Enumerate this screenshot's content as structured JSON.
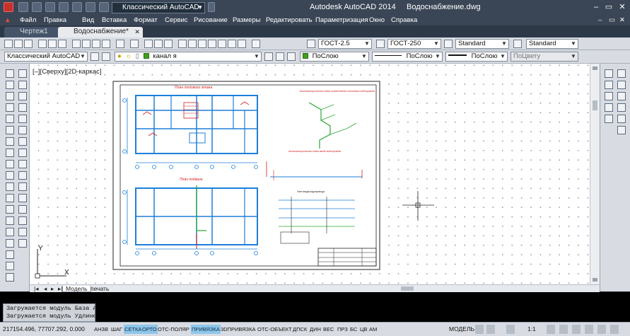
{
  "window": {
    "app_title": "Autodesk AutoCAD 2014",
    "document_title": "Водоснабжение.dwg",
    "workspace": "Классический AutoCAD",
    "controls": {
      "minimize": "–",
      "maximize": "▭",
      "close": "✕"
    }
  },
  "menu": [
    "Файл",
    "Правка",
    "Вид",
    "Вставка",
    "Формат",
    "Сервис",
    "Рисование",
    "Размеры",
    "Редактировать",
    "Параметризация",
    "Окно",
    "Справка"
  ],
  "tabs": [
    {
      "label": "Чертеж1",
      "active": false
    },
    {
      "label": "Водоснабжение*",
      "active": true
    }
  ],
  "toolbar1": {
    "text_style": "ГОСТ-2.5",
    "dim_style": "ГОСТ-250",
    "table_style": "Standard",
    "mleader_style": "Standard"
  },
  "toolbar2": {
    "workspace": "Классический AutoCAD",
    "layer": "канал я",
    "color": "ПоСлою",
    "linetype": "ПоСлою",
    "lineweight": "ПоСлою",
    "plotstyle": "ПоЦвету",
    "layer_color": "#3fa01c"
  },
  "viewport": {
    "label": "[–][Сверху][2D-каркас]",
    "ucs_x": "X",
    "ucs_y": "Y"
  },
  "drawing": {
    "plan1_title": "План типового этажа",
    "plan2_title": "План подвала",
    "scheme1_title": "Аксонометрическая схема хозяйственно-питьевого водопровода",
    "scheme2_title": "Аксонометрическая схема ввода водопровода",
    "node_title": "Узел ввода водопровода"
  },
  "layout_tabs": [
    {
      "label": "Модель",
      "active": true
    },
    {
      "label": "печать",
      "active": false
    }
  ],
  "command_lines": [
    "Загружается модуль База А",
    "Загружается модуль Удлине"
  ],
  "status": {
    "coords": "217154.496, 77707.292, 0.000",
    "buttons": [
      {
        "label": "АНЗВ",
        "on": false
      },
      {
        "label": "ШАГ",
        "on": false
      },
      {
        "label": "СЕТКА",
        "on": true
      },
      {
        "label": "ОРТО",
        "on": true
      },
      {
        "label": "ОТС-ПОЛЯР",
        "on": false
      },
      {
        "label": "ПРИВЯЗКА",
        "on": true
      },
      {
        "label": "3DПРИВЯЗКА",
        "on": false
      },
      {
        "label": "ОТС-ОБЪЕКТ",
        "on": false
      },
      {
        "label": "ДПСК",
        "on": false
      },
      {
        "label": "ДИН",
        "on": false
      },
      {
        "label": "ВЕС",
        "on": false
      },
      {
        "label": "ПРЗ",
        "on": false
      },
      {
        "label": "БС",
        "on": false
      },
      {
        "label": "ЦВ",
        "on": false
      },
      {
        "label": "АМ",
        "on": false
      }
    ],
    "model_label": "МОДЕЛЬ",
    "scale": "1:1"
  }
}
